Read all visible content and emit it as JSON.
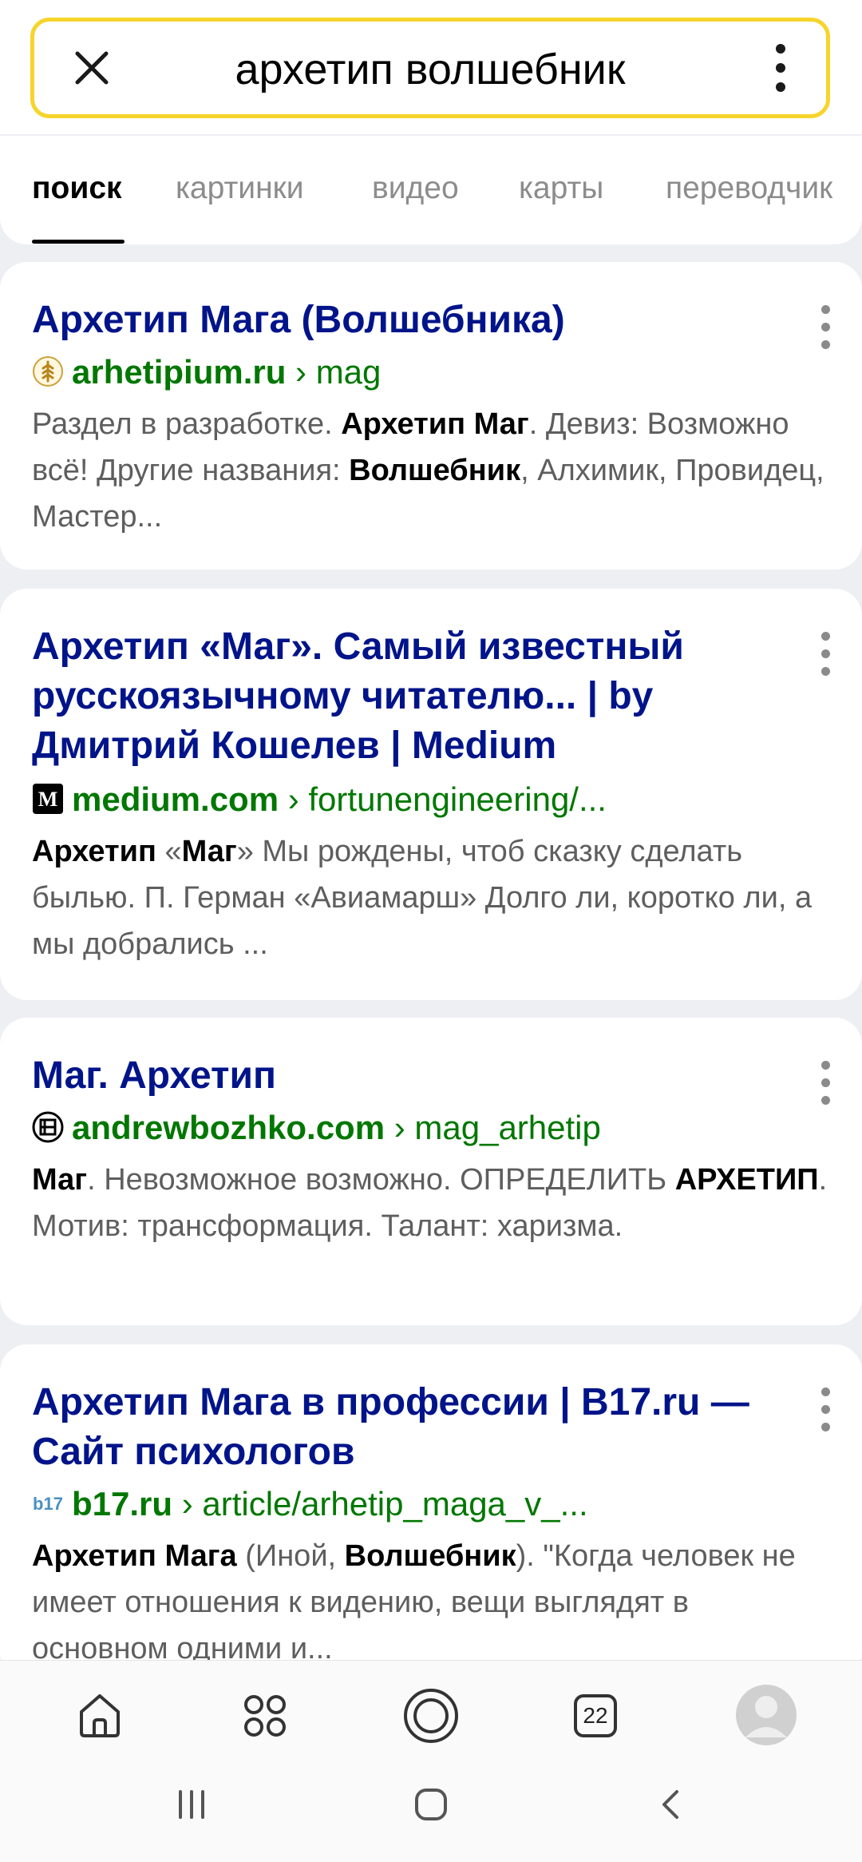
{
  "search": {
    "query": "архетип волшебник"
  },
  "tabs": [
    "поиск",
    "картинки",
    "видео",
    "карты",
    "переводчик"
  ],
  "results": [
    {
      "title": "Архетип Мага (Волшебника)",
      "domain": "arhetipium.ru",
      "path": " › mag",
      "favicon": "wheat-icon",
      "snippet_parts": [
        {
          "t": "Раздел в разработке. ",
          "b": false
        },
        {
          "t": "Архетип Маг",
          "b": true
        },
        {
          "t": ". Девиз: Возможно всё! Другие названия: ",
          "b": false
        },
        {
          "t": "Волшебник",
          "b": true
        },
        {
          "t": ", Алхимик, Провидец, Мастер...",
          "b": false
        }
      ]
    },
    {
      "title": "Архетип «Маг». Самый известный русскоязычному читателю... | by Дмитрий Кошелев | Medium",
      "domain": "medium.com",
      "path": " › fortunengineering/...",
      "favicon": "medium-icon",
      "snippet_parts": [
        {
          "t": "Архетип",
          "b": true
        },
        {
          "t": " «",
          "b": false
        },
        {
          "t": "Маг",
          "b": true
        },
        {
          "t": "» Мы рождены, чтоб сказку сделать былью. П. Герман «Авиамарш» Долго ли, коротко ли, а мы добрались ...",
          "b": false
        }
      ]
    },
    {
      "title": "Маг. Архетип",
      "domain": "andrewbozhko.com",
      "path": " › mag_arhetip",
      "favicon": "ab-logo-icon",
      "snippet_parts": [
        {
          "t": "Маг",
          "b": true
        },
        {
          "t": ". Невозможное возможно. ОПРЕДЕЛИТЬ ",
          "b": false
        },
        {
          "t": "АРХЕТИП",
          "b": true
        },
        {
          "t": ". Мотив: трансформация. Талант: харизма.",
          "b": false
        }
      ]
    },
    {
      "title": "Архетип Мага в профессии | B17.ru — Сайт психологов",
      "domain": "b17.ru",
      "path": " › article/arhetip_maga_v_...",
      "favicon": "b17-icon",
      "snippet_parts": [
        {
          "t": "Архетип Мага",
          "b": true
        },
        {
          "t": " (Иной, ",
          "b": false
        },
        {
          "t": "Волшебник",
          "b": true
        },
        {
          "t": "). \"Когда человек не имеет отношения к видению, вещи выглядят в основном одними и...",
          "b": false
        }
      ]
    }
  ],
  "bottom_nav": {
    "tabs_count": "22",
    "icons": [
      "home-icon",
      "services-grid-icon",
      "alice-icon",
      "tabs-icon",
      "profile-avatar"
    ]
  },
  "system_nav": [
    "recents-icon",
    "home-circle-icon",
    "back-icon"
  ],
  "colors": {
    "accent_yellow": "#f7d42c",
    "title_blue": "#00148a",
    "url_green": "#007700"
  }
}
